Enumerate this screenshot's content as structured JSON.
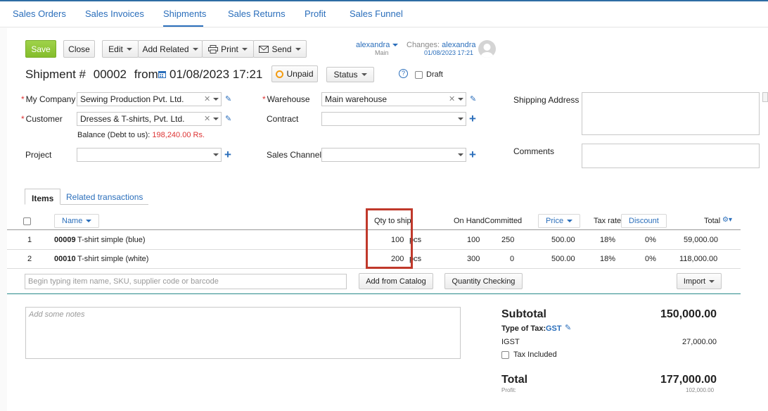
{
  "nav": {
    "items": [
      "Sales Orders",
      "Sales Invoices",
      "Shipments",
      "Sales Returns",
      "Profit",
      "Sales Funnel"
    ],
    "active": "Shipments"
  },
  "toolbar": {
    "save": "Save",
    "close": "Close",
    "edit": "Edit",
    "add_related": "Add Related",
    "print": "Print",
    "send": "Send",
    "user_name": "alexandra",
    "user_sub": "Main",
    "changes_label": "Changes:",
    "changes_user": "alexandra",
    "changes_date": "01/08/2023 17:21"
  },
  "header": {
    "doc_label": "Shipment #",
    "doc_number": "00002",
    "from_label": "from",
    "date": "01/08/2023 17:21",
    "payment_status": "Unpaid",
    "status_label": "Status",
    "draft_label": "Draft",
    "help": "?"
  },
  "form": {
    "my_company_label": "My Company",
    "my_company_value": "Sewing Production Pvt. Ltd.",
    "customer_label": "Customer",
    "customer_value": "Dresses & T-shirts, Pvt. Ltd.",
    "balance_label": "Balance (Debt to us):",
    "balance_value": "198,240.00 Rs.",
    "project_label": "Project",
    "warehouse_label": "Warehouse",
    "warehouse_value": "Main warehouse",
    "contract_label": "Contract",
    "sales_channel_label": "Sales Channel",
    "shipping_address_label": "Shipping Address",
    "comments_label": "Comments"
  },
  "tabs": [
    "Items",
    "Related transactions"
  ],
  "table": {
    "headers": {
      "name": "Name",
      "qty": "Qty to ship",
      "on_hand": "On Hand",
      "committed": "Committed",
      "price": "Price",
      "tax_rate": "Tax rate",
      "discount": "Discount",
      "total": "Total"
    },
    "rows": [
      {
        "num": "1",
        "sku": "00009",
        "name": "T-shirt simple (blue)",
        "qty": "100",
        "unit": "pcs",
        "on_hand": "100",
        "committed": "250",
        "price": "500.00",
        "tax": "18%",
        "discount": "0%",
        "total": "59,000.00"
      },
      {
        "num": "2",
        "sku": "00010",
        "name": "T-shirt simple (white)",
        "qty": "200",
        "unit": "pcs",
        "on_hand": "300",
        "committed": "0",
        "price": "500.00",
        "tax": "18%",
        "discount": "0%",
        "total": "118,000.00"
      }
    ],
    "search_placeholder": "Begin typing item name, SKU, supplier code or barcode",
    "add_from_catalog": "Add from Catalog",
    "quantity_checking": "Quantity Checking",
    "import": "Import"
  },
  "notes": {
    "placeholder": "Add some notes"
  },
  "summary": {
    "subtotal_label": "Subtotal",
    "subtotal_value": "150,000.00",
    "tax_type_label": "Type of Tax:",
    "tax_type_value": "GST",
    "igst_label": "IGST",
    "igst_value": "27,000.00",
    "tax_included_label": "Tax Included",
    "total_label": "Total",
    "total_value": "177,000.00",
    "profit_label": "Profit:",
    "profit_value": "102,000.00"
  },
  "colors": {
    "accent": "#2a6ebb",
    "save": "#8cc63f",
    "highlight": "#c0392b",
    "balance": "#d33"
  }
}
